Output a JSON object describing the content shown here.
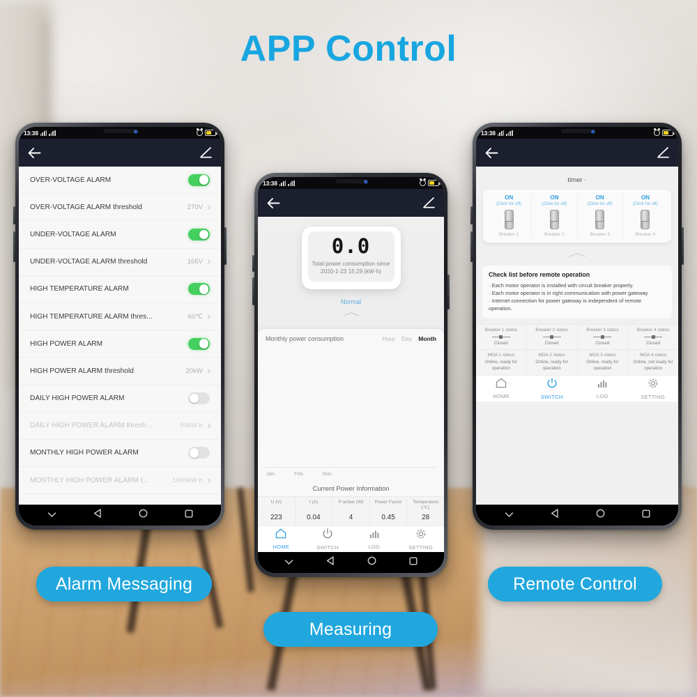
{
  "headline": "APP Control",
  "accent_blue": "#18a6e0",
  "pill_blue": "#21a7dd",
  "toggle_green": "#45cf5f",
  "appbar_color": "#1b1f2e",
  "status_bar": {
    "time": "13:38"
  },
  "appbar": {
    "back_icon": "arrow-left-icon",
    "edit_icon": "pencil-edit-icon"
  },
  "android_nav": {
    "items": [
      "chevron-down-icon",
      "back-triangle-icon",
      "home-circle-icon",
      "recents-square-icon"
    ]
  },
  "phone1": {
    "caption": "Alarm Messaging",
    "rows": [
      {
        "label": "OVER-VOLTAGE ALARM",
        "type": "toggle",
        "state": "on"
      },
      {
        "label": "OVER-VOLTAGE ALARM threshold",
        "type": "value",
        "value": "270V"
      },
      {
        "label": "UNDER-VOLTAGE ALARM",
        "type": "toggle",
        "state": "on"
      },
      {
        "label": "UNDER-VOLTAGE ALARM threshold",
        "type": "value",
        "value": "165V"
      },
      {
        "label": "HIGH TEMPERATURE ALARM",
        "type": "toggle",
        "state": "on"
      },
      {
        "label": "HIGH TEMPERATURE ALARM thres...",
        "type": "value",
        "value": "60℃"
      },
      {
        "label": "HIGH POWER ALARM",
        "type": "toggle",
        "state": "on"
      },
      {
        "label": "HIGH POWER ALARM threshold",
        "type": "value",
        "value": "20kW"
      },
      {
        "label": "DAILY HIGH POWER ALARM",
        "type": "toggle",
        "state": "off"
      },
      {
        "label": "DAILY HIGH POWER ALARM thresh...",
        "type": "value",
        "value": "50kW·h",
        "dim": true
      },
      {
        "label": "MONTHLY HIGH POWER ALARM",
        "type": "toggle",
        "state": "off"
      },
      {
        "label": "MONTHLY HIGH POWER ALARM t...",
        "type": "value",
        "value": "1000kW·h",
        "dim": true
      }
    ]
  },
  "phone2": {
    "caption": "Measuring",
    "gauge": {
      "value": "0.0",
      "caption_line1": "Total power consumption since",
      "caption_line2": "2020-1-23 15:29 (kW·h)"
    },
    "status_text": "Normal",
    "panel": {
      "title": "Monthly power consumption",
      "segments": [
        "Hour",
        "Day",
        "Month"
      ],
      "active_segment": "Month"
    },
    "chart_data": {
      "type": "bar",
      "title": "Monthly power consumption",
      "categories": [
        "Jan.",
        "Feb.",
        "Mar."
      ],
      "values": [
        0,
        0,
        0
      ],
      "xlabel": "",
      "ylabel": "",
      "ylim": [
        0,
        1
      ],
      "grid": false,
      "legend": "none"
    },
    "current_power": {
      "title": "Current Power Information",
      "headers": [
        "U (V)",
        "I (A)",
        "P active (W)",
        "Power Factor",
        "Temperature (℃)"
      ],
      "values": [
        "223",
        "0.04",
        "4",
        "0.45",
        "28"
      ]
    },
    "tabs": [
      {
        "label": "HOME",
        "icon": "home-icon",
        "active": true
      },
      {
        "label": "SWITCH",
        "icon": "power-icon",
        "active": false
      },
      {
        "label": "LOG",
        "icon": "bar-chart-icon",
        "active": false
      },
      {
        "label": "SETTING",
        "icon": "gear-icon",
        "active": false
      }
    ]
  },
  "phone3": {
    "caption": "Remote Control",
    "timer_label": "timer ·",
    "breakers": [
      {
        "state": "ON",
        "hint": "(Click for off)",
        "name": "Breaker 1"
      },
      {
        "state": "ON",
        "hint": "(Click for off)",
        "name": "Breaker 2"
      },
      {
        "state": "ON",
        "hint": "(Click for off)",
        "name": "Breaker 3"
      },
      {
        "state": "ON",
        "hint": "(Click for off)",
        "name": "Breaker 4"
      }
    ],
    "checklist": {
      "title": "Check list before remote operation",
      "items": [
        "· Each motor operator is installed with circuit breaker properly.",
        "· Each motor operator is in right communication with power gateway.",
        "· Internet connection for power gateway is independent of remote operation."
      ]
    },
    "breaker_status": {
      "headers": [
        "Breaker 1 status",
        "Breaker 2 status",
        "Breaker 3 status",
        "Breaker 4 status"
      ],
      "values": [
        "Closed",
        "Closed",
        "Closed",
        "Closed"
      ]
    },
    "moa_status": {
      "headers": [
        "MOA 1 status",
        "MOA 2 status",
        "MOA 3 status",
        "MOA 4 status"
      ],
      "values": [
        "Online, ready for operation",
        "Online, ready for operation",
        "Online, ready for operation",
        "Online, not ready for operation"
      ]
    },
    "tabs": [
      {
        "label": "HOME",
        "icon": "home-icon",
        "active": false
      },
      {
        "label": "SWITCH",
        "icon": "power-icon",
        "active": true
      },
      {
        "label": "LOG",
        "icon": "bar-chart-icon",
        "active": false
      },
      {
        "label": "SETTING",
        "icon": "gear-icon",
        "active": false
      }
    ]
  }
}
